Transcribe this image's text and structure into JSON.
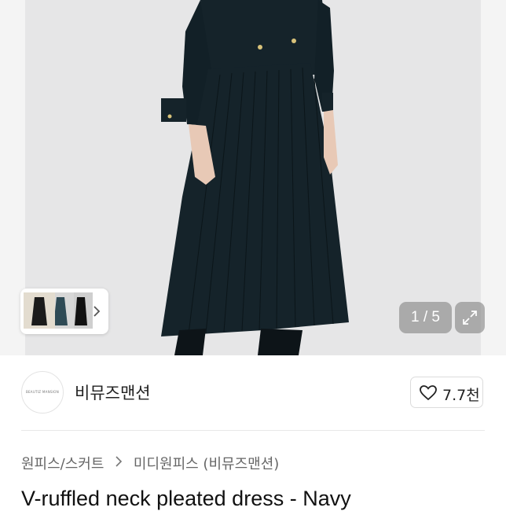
{
  "gallery": {
    "counter": "1 / 5",
    "thumbnail_icon": "chevron-right-icon",
    "expand_icon": "expand-icon"
  },
  "seller": {
    "avatar_text": "BEAUTIZ MANSION",
    "name": "비뮤즈맨션"
  },
  "like": {
    "icon": "heart-icon",
    "count": "7.7천"
  },
  "breadcrumb": {
    "category": "원피스/스커트",
    "subcategory": "미디원피스 (비뮤즈맨션)",
    "separator_icon": "chevron-right-icon"
  },
  "product": {
    "title": "V-ruffled neck pleated dress - Navy"
  },
  "colors": {
    "dress": "#15232a",
    "background": "#e6e6e7"
  }
}
